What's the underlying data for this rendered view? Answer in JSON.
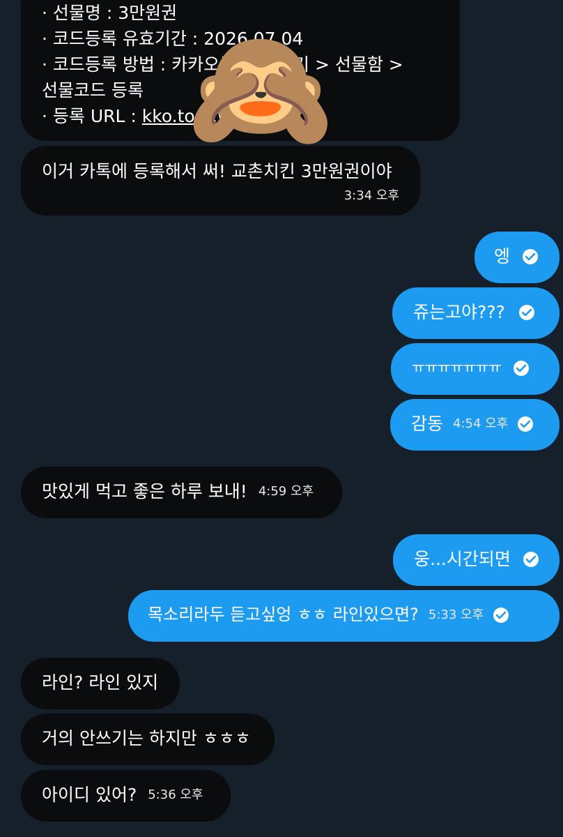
{
  "gift_card": {
    "line1": "· 선물명 : 3만원권",
    "line2": "· 코드등록 유효기간 : 2026.07.04",
    "line3": "· 코드등록 방법 : 카카오톡 > 더보기 > 선물함 >",
    "line4": "선물코드 등록",
    "line5_prefix": "· 등록 URL : ",
    "line5_link": "kko.to/...w"
  },
  "messages": [
    {
      "side": "in",
      "text": "이거 카톡에 등록해서 써! 교촌치킨 3만원권이야",
      "time": "3:34 오후"
    },
    {
      "side": "out",
      "text": "엥",
      "time": ""
    },
    {
      "side": "out",
      "text": "쥬는고야???",
      "time": ""
    },
    {
      "side": "out",
      "text": "ㅠㅠㅠㅠㅠㅠㅠ",
      "time": ""
    },
    {
      "side": "out",
      "text": "감동",
      "time": "4:54 오후"
    },
    {
      "side": "in",
      "text": "맛있게 먹고 좋은 하루 보내!",
      "time": "4:59 오후"
    },
    {
      "side": "out",
      "text": "웅...시간되면",
      "time": ""
    },
    {
      "side": "out",
      "text": "목소리라두 듣고싶엉 ㅎㅎ 라인있으면?",
      "time": "5:33 오후"
    },
    {
      "side": "in",
      "text": "라인? 라인 있지",
      "time": ""
    },
    {
      "side": "in",
      "text": "거의 안쓰기는 하지만 ㅎㅎㅎ",
      "time": ""
    },
    {
      "side": "in",
      "text": "아이디 있어?",
      "time": "5:36 오후"
    }
  ],
  "sticker": {
    "emoji": "🙈",
    "name": "see-no-evil-monkey-sticker"
  },
  "colors": {
    "background": "#15202b",
    "incoming": "#0b0c0d",
    "outgoing": "#1d9bf0"
  }
}
